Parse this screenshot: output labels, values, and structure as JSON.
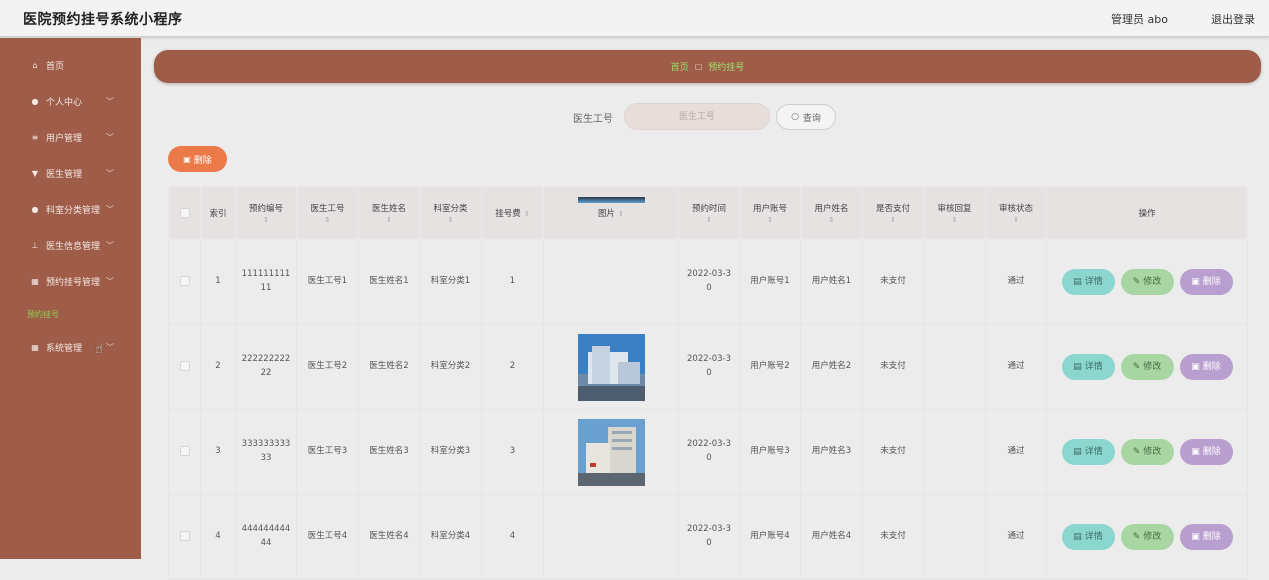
{
  "header": {
    "title": "医院预约挂号系统小程序",
    "admin_label": "管理员 abo",
    "logout_label": "退出登录"
  },
  "sidebar": {
    "items": [
      {
        "label": "首页",
        "icon": "home-icon",
        "glyph": "⌂",
        "chevron": false
      },
      {
        "label": "个人中心",
        "icon": "user-icon",
        "glyph": "●",
        "chevron": true
      },
      {
        "label": "用户管理",
        "icon": "list-icon",
        "glyph": "≡",
        "chevron": true
      },
      {
        "label": "医生管理",
        "icon": "doctor-icon",
        "glyph": "▼",
        "chevron": true
      },
      {
        "label": "科室分类管理",
        "icon": "person-icon",
        "glyph": "●",
        "chevron": true
      },
      {
        "label": "医生信息管理",
        "icon": "doctor-info-icon",
        "glyph": "⊥",
        "chevron": true
      },
      {
        "label": "预约挂号管理",
        "icon": "grid-icon",
        "glyph": "▦",
        "chevron": true
      },
      {
        "label": "系统管理",
        "icon": "grid-icon",
        "glyph": "▦",
        "chevron": true
      }
    ],
    "sub_item": "预约挂号"
  },
  "breadcrumb": {
    "home": "首页",
    "separator": "▢",
    "current": "预约挂号"
  },
  "search": {
    "label": "医生工号",
    "placeholder": "医生工号",
    "button": "查询"
  },
  "toolbar": {
    "delete_label": "删除"
  },
  "table": {
    "headers": {
      "index": "索引",
      "booking_no": "预约编号",
      "doctor_id": "医生工号",
      "doctor_name": "医生姓名",
      "department": "科室分类",
      "fee": "挂号费",
      "image": "图片",
      "time": "预约时间",
      "user_account": "用户账号",
      "user_name": "用户姓名",
      "paid": "是否支付",
      "review_reply": "审核回复",
      "review_status": "审核状态",
      "actions": "操作"
    },
    "actions": {
      "detail": "详情",
      "edit": "修改",
      "delete": "删除"
    },
    "rows": [
      {
        "index": "1",
        "booking_no_a": "111111111",
        "booking_no_b": "11",
        "doctor_id": "医生工号1",
        "doctor_name": "医生姓名1",
        "department": "科室分类1",
        "fee": "1",
        "time_a": "2022-03-3",
        "time_b": "0",
        "user_account": "用户账号1",
        "user_name": "用户姓名1",
        "paid": "未支付",
        "review_reply": "",
        "review_status": "通过"
      },
      {
        "index": "2",
        "booking_no_a": "222222222",
        "booking_no_b": "22",
        "doctor_id": "医生工号2",
        "doctor_name": "医生姓名2",
        "department": "科室分类2",
        "fee": "2",
        "time_a": "2022-03-3",
        "time_b": "0",
        "user_account": "用户账号2",
        "user_name": "用户姓名2",
        "paid": "未支付",
        "review_reply": "",
        "review_status": "通过"
      },
      {
        "index": "3",
        "booking_no_a": "333333333",
        "booking_no_b": "33",
        "doctor_id": "医生工号3",
        "doctor_name": "医生姓名3",
        "department": "科室分类3",
        "fee": "3",
        "time_a": "2022-03-3",
        "time_b": "0",
        "user_account": "用户账号3",
        "user_name": "用户姓名3",
        "paid": "未支付",
        "review_reply": "",
        "review_status": "通过"
      },
      {
        "index": "4",
        "booking_no_a": "444444444",
        "booking_no_b": "44",
        "doctor_id": "医生工号4",
        "doctor_name": "医生姓名4",
        "department": "科室分类4",
        "fee": "4",
        "time_a": "2022-03-3",
        "time_b": "0",
        "user_account": "用户账号4",
        "user_name": "用户姓名4",
        "paid": "未支付",
        "review_reply": "",
        "review_status": "通过"
      }
    ]
  },
  "colors": {
    "primary": "#9f5c48",
    "accent_green": "#8fd14f",
    "delete_orange": "#ec7a48",
    "detail": "#8cd6d0",
    "edit": "#a8d6a2",
    "remove": "#b99ed0"
  }
}
